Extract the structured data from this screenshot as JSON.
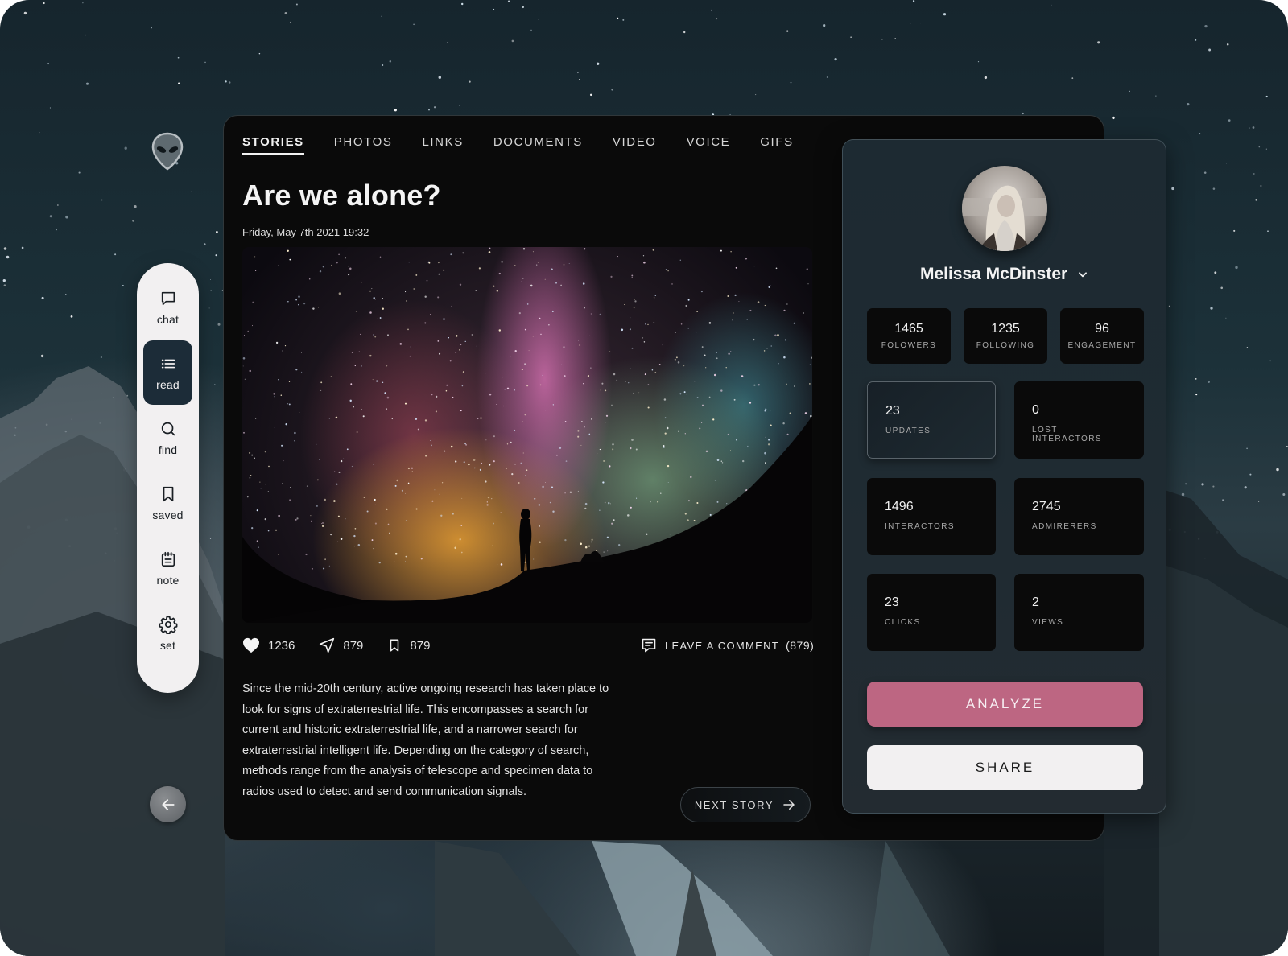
{
  "nav": {
    "items": [
      {
        "label": "chat",
        "icon": "chat-bubble-icon",
        "active": false
      },
      {
        "label": "read",
        "icon": "list-icon",
        "active": true
      },
      {
        "label": "find",
        "icon": "search-icon",
        "active": false
      },
      {
        "label": "saved",
        "icon": "bookmark-icon",
        "active": false
      },
      {
        "label": "note",
        "icon": "notepad-icon",
        "active": false
      },
      {
        "label": "set",
        "icon": "gear-icon",
        "active": false
      }
    ],
    "logo_icon": "alien-head-icon",
    "back_icon": "arrow-left-icon"
  },
  "tabs": [
    {
      "label": "STORIES",
      "active": true
    },
    {
      "label": "PHOTOS",
      "active": false
    },
    {
      "label": "LINKS",
      "active": false
    },
    {
      "label": "DOCUMENTS",
      "active": false
    },
    {
      "label": "VIDEO",
      "active": false
    },
    {
      "label": "VOICE",
      "active": false
    },
    {
      "label": "GIFS",
      "active": false
    }
  ],
  "story": {
    "title": "Are we alone?",
    "date": "Friday, May 7th 2021 19:32",
    "image_alt": "Person silhouette under colorful Milky Way night sky",
    "likes": "1236",
    "shares": "879",
    "saves": "879",
    "comment_label": "LEAVE A COMMENT",
    "comment_count": "(879)",
    "body": "Since the mid-20th century, active ongoing research has taken place to look for signs of extraterrestrial life. This encompasses a search for current and historic extraterrestrial life, and a narrower search for extraterrestrial intelligent life. Depending on the category of search, methods range from the analysis of telescope and specimen data to radios used to detect and send communication signals.",
    "next_label": "NEXT STORY"
  },
  "profile": {
    "name": "Melissa McDinster",
    "top_stats": [
      {
        "value": "1465",
        "label": "FOLOWERS"
      },
      {
        "value": "1235",
        "label": "FOLLOWING"
      },
      {
        "value": "96",
        "label": "ENGAGEMENT"
      }
    ],
    "cards": [
      {
        "value": "23",
        "label": "UPDATES",
        "selected": true
      },
      {
        "value": "0",
        "label": "LOST INTERACTORS",
        "selected": false
      },
      {
        "value": "1496",
        "label": "INTERACTORS",
        "selected": false
      },
      {
        "value": "2745",
        "label": "ADMIRERERS",
        "selected": false
      },
      {
        "value": "23",
        "label": "CLICKS",
        "selected": false
      },
      {
        "value": "2",
        "label": "VIEWS",
        "selected": false
      }
    ],
    "analyze_label": "ANALYZE",
    "share_label": "SHARE"
  },
  "colors": {
    "accent": "#bd6682",
    "nav_active": "#1c2c38",
    "panel": "#0a0a0a",
    "profile_panel": "#1f2b32",
    "light_button": "#f2f0f1"
  }
}
